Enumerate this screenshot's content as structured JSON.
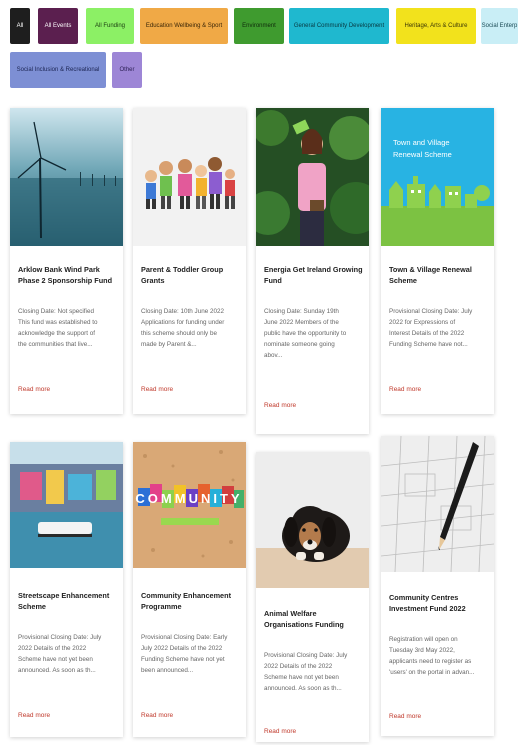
{
  "filters": [
    {
      "label": "All",
      "bg": "#1e1e1e",
      "fg": "#ffffff"
    },
    {
      "label": "All Events",
      "bg": "#5b1f4f",
      "fg": "#ffffff"
    },
    {
      "label": "All Funding",
      "bg": "#8cf065",
      "fg": "#1a3b10"
    },
    {
      "label": "Education Wellbeing & Sport",
      "bg": "#f0a946",
      "fg": "#3a2608"
    },
    {
      "label": "Environment",
      "bg": "#3f9b2f",
      "fg": "#0f2a0b"
    },
    {
      "label": "General Community Development",
      "bg": "#1fb8cf",
      "fg": "#083840"
    },
    {
      "label": "Heritage, Arts & Culture",
      "bg": "#f2e21c",
      "fg": "#3b3705"
    },
    {
      "label": "Social Enterp",
      "bg": "#c9eef6",
      "fg": "#1c4b55"
    },
    {
      "label": "Social Inclusion & Recreational",
      "bg": "#7d8fd4",
      "fg": "#1b2452"
    },
    {
      "label": "Other",
      "bg": "#9d86d6",
      "fg": "#2a1d52"
    }
  ],
  "cards": [
    {
      "title_lines": [
        "Arklow Bank Wind Park",
        "Phase 2 Sponsorship Fund"
      ],
      "excerpt_lines": [
        "Closing Date: Not specified",
        "This fund was established to",
        "acknowledge the support of",
        "the communities that live..."
      ],
      "read_more": "Read more",
      "image": "wind-turbine"
    },
    {
      "title_lines": [
        "Parent & Toddler Group",
        "Grants"
      ],
      "excerpt_lines": [
        "Closing Date: 10th June 2022",
        "Applications for funding under",
        "this scheme should only be",
        "made by Parent &..."
      ],
      "read_more": "Read more",
      "image": "children"
    },
    {
      "title_lines": [
        "Energia Get Ireland Growing",
        "Fund"
      ],
      "excerpt_lines": [
        "Closing Date: Sunday 19th",
        "June 2022 Members of the",
        "public have the opportunity to",
        "nominate someone going",
        "abov..."
      ],
      "read_more": "Read more",
      "image": "gardener"
    },
    {
      "title_lines": [
        "Town & Village Renewal",
        "Scheme"
      ],
      "excerpt_lines": [
        "Provisional Closing Date: July",
        "2022 for Expressions of",
        "Interest Details of the 2022",
        "Funding Scheme have not..."
      ],
      "read_more": "Read more",
      "image": "town-village",
      "image_text_lines": [
        "Town and Village",
        "Renewal Scheme"
      ]
    },
    {
      "title_lines": [
        "Streetscape Enhancement",
        "Scheme"
      ],
      "excerpt_lines": [
        "Provisional Closing Date: July",
        "2022 Details of the 2022",
        "Scheme have not yet been",
        "announced. As soon as th..."
      ],
      "read_more": "Read more",
      "image": "streetscape"
    },
    {
      "title_lines": [
        "Community Enhancement",
        "Programme"
      ],
      "excerpt_lines": [
        "Provisional Closing Date: Early",
        "July 2022 Details of the 2022",
        "Funding Scheme have not yet",
        "been announced..."
      ],
      "read_more": "Read more",
      "image": "community-letters",
      "image_text": "COMMUNITY"
    },
    {
      "title_lines": [
        "Animal Welfare",
        "Organisations Funding"
      ],
      "excerpt_lines": [
        "Provisional Closing Date: July",
        "2022 Details of the 2022",
        "Scheme have not yet been",
        "announced. As soon as th..."
      ],
      "read_more": "Read more",
      "image": "dog"
    },
    {
      "title_lines": [
        "Community Centres",
        "Investment Fund 2022"
      ],
      "excerpt_lines": [
        "Registration will open on",
        "Tuesday 3rd May 2022,",
        "applicants need to register as",
        "'users' on the portal in advan..."
      ],
      "read_more": "Read more",
      "image": "pencil-plan"
    }
  ]
}
